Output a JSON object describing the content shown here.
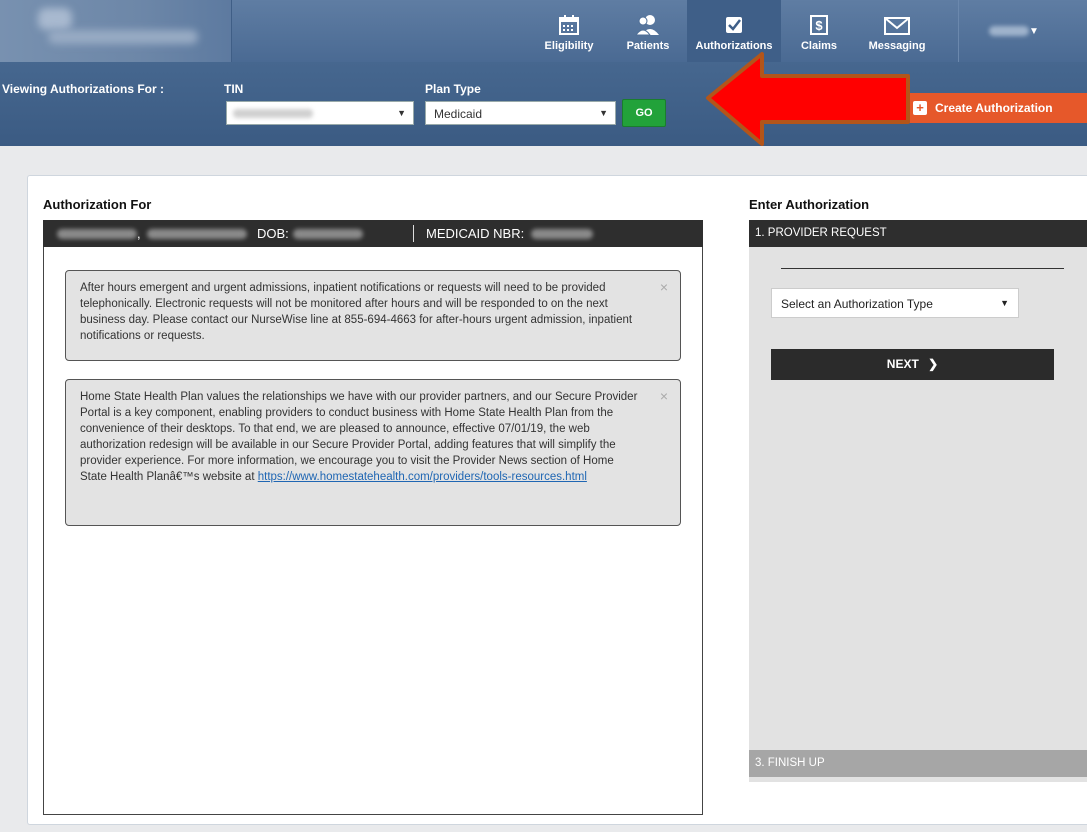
{
  "nav": {
    "items": [
      {
        "label": "Eligibility",
        "icon": "calendar-icon"
      },
      {
        "label": "Patients",
        "icon": "patients-icon"
      },
      {
        "label": "Authorizations",
        "icon": "checkbox-icon"
      },
      {
        "label": "Claims",
        "icon": "dollar-icon"
      },
      {
        "label": "Messaging",
        "icon": "envelope-icon"
      }
    ],
    "active": "Authorizations"
  },
  "filter": {
    "viewing_label": "Viewing Authorizations For :",
    "tin_label": "TIN",
    "plan_type_label": "Plan Type",
    "plan_type_value": "Medicaid",
    "go_label": "GO",
    "create_label": "Create Authorization"
  },
  "left": {
    "title": "Authorization For",
    "comma": ",",
    "dob_label": "DOB:",
    "medicaid_label": "MEDICAID NBR:",
    "notices": [
      {
        "text": "After hours emergent and urgent admissions, inpatient notifications or requests will need to be provided telephonically. Electronic requests will not be monitored after hours and will be responded to on the next business day. Please contact our NurseWise line at 855-694-4663 for after-hours urgent admission, inpatient notifications or requests."
      },
      {
        "text": "Home State Health Plan values the relationships we have with our provider partners, and our Secure Provider Portal is a key component, enabling providers to conduct business with Home State Health Plan from the convenience of their desktops. To that end, we are pleased to announce, effective 07/01/19, the web authorization redesign will be available in our Secure Provider Portal, adding features that will simplify the provider experience. For more information, we encourage you to visit the Provider News section of Home State Health Planâ€™s website at",
        "link": "https://www.homestatehealth.com/providers/tools-resources.html"
      }
    ],
    "close_glyph": "×"
  },
  "right": {
    "title": "Enter Authorization",
    "step1": "1. PROVIDER REQUEST",
    "auth_type_placeholder": "Select an Authorization Type",
    "next_label": "NEXT",
    "step3": "3. FINISH UP"
  },
  "colors": {
    "nav_bg": "#4f6f97",
    "go_button": "#22a23a",
    "create_button": "#e6582a",
    "annotation_arrow": "#ff0000"
  }
}
